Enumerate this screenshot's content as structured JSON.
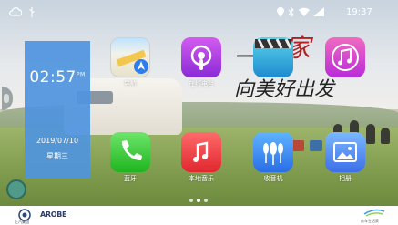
{
  "status_bar": {
    "left_icons": [
      "cloud-icon",
      "usb-icon"
    ],
    "right_icons": [
      "location-icon",
      "bluetooth-icon",
      "wifi-icon",
      "signal-icon"
    ],
    "time": "19:37"
  },
  "clock_widget": {
    "time": "02:57",
    "meridiem": "PM",
    "date": "2019/07/10",
    "weekday": "星期三"
  },
  "apps": [
    {
      "name": "maps",
      "label": "导航",
      "icon": "maps-icon"
    },
    {
      "name": "podcast",
      "label": "在线电台",
      "icon": "podcast-icon"
    },
    {
      "name": "video",
      "label": "",
      "icon": "video-clapper-icon"
    },
    {
      "name": "music-top",
      "label": "",
      "icon": "music-note-icon"
    },
    {
      "name": "phone",
      "label": "蓝牙",
      "icon": "phone-icon"
    },
    {
      "name": "music",
      "label": "本地音乐",
      "icon": "music-icon"
    },
    {
      "name": "radio",
      "label": "收音机",
      "icon": "radio-icon"
    },
    {
      "name": "gallery",
      "label": "相册",
      "icon": "gallery-icon"
    }
  ],
  "wallpaper_text": "一家 向美好出发",
  "pagination": {
    "pages": 3,
    "current": 2
  },
  "bottom_bar": {
    "left_logo_text": "上汽集团",
    "middle_logo_text": "AROBE",
    "right_logo_text": "房车生活家"
  },
  "colors": {
    "clock_card": "#4f94de",
    "accent": "#ffffff"
  }
}
